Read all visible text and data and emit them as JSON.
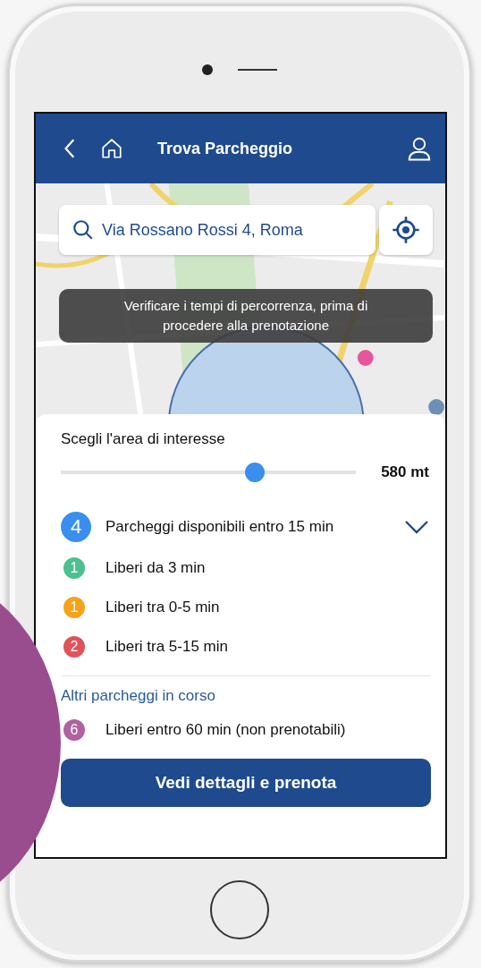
{
  "header": {
    "title": "Trova Parcheggio"
  },
  "search": {
    "value": "Via Rossano Rossi 4, Roma"
  },
  "notice": "Verificare i tempi di percorrenza, prima di procedere alla prenotazione",
  "area": {
    "label": "Scegli l'area di interesse",
    "level": 0.67,
    "reading": "580 mt"
  },
  "summary": {
    "count": "4",
    "label": "Parcheggi disponibili entro 15 min"
  },
  "groups": [
    {
      "count": "1",
      "label": "Liberi da 3 min",
      "color": "#4cc08f"
    },
    {
      "count": "1",
      "label": "Liberi tra 0-5 min",
      "color": "#f7a21b"
    },
    {
      "count": "2",
      "label": "Liberi tra 5-15 min",
      "color": "#e0535a"
    }
  ],
  "other": {
    "title": "Altri parcheggi in corso",
    "items": [
      {
        "count": "6",
        "label": "Liberi entro 60 min (non prenotabili)",
        "color": "#b0619f"
      }
    ]
  },
  "button": "Vedi dettagli e prenota"
}
